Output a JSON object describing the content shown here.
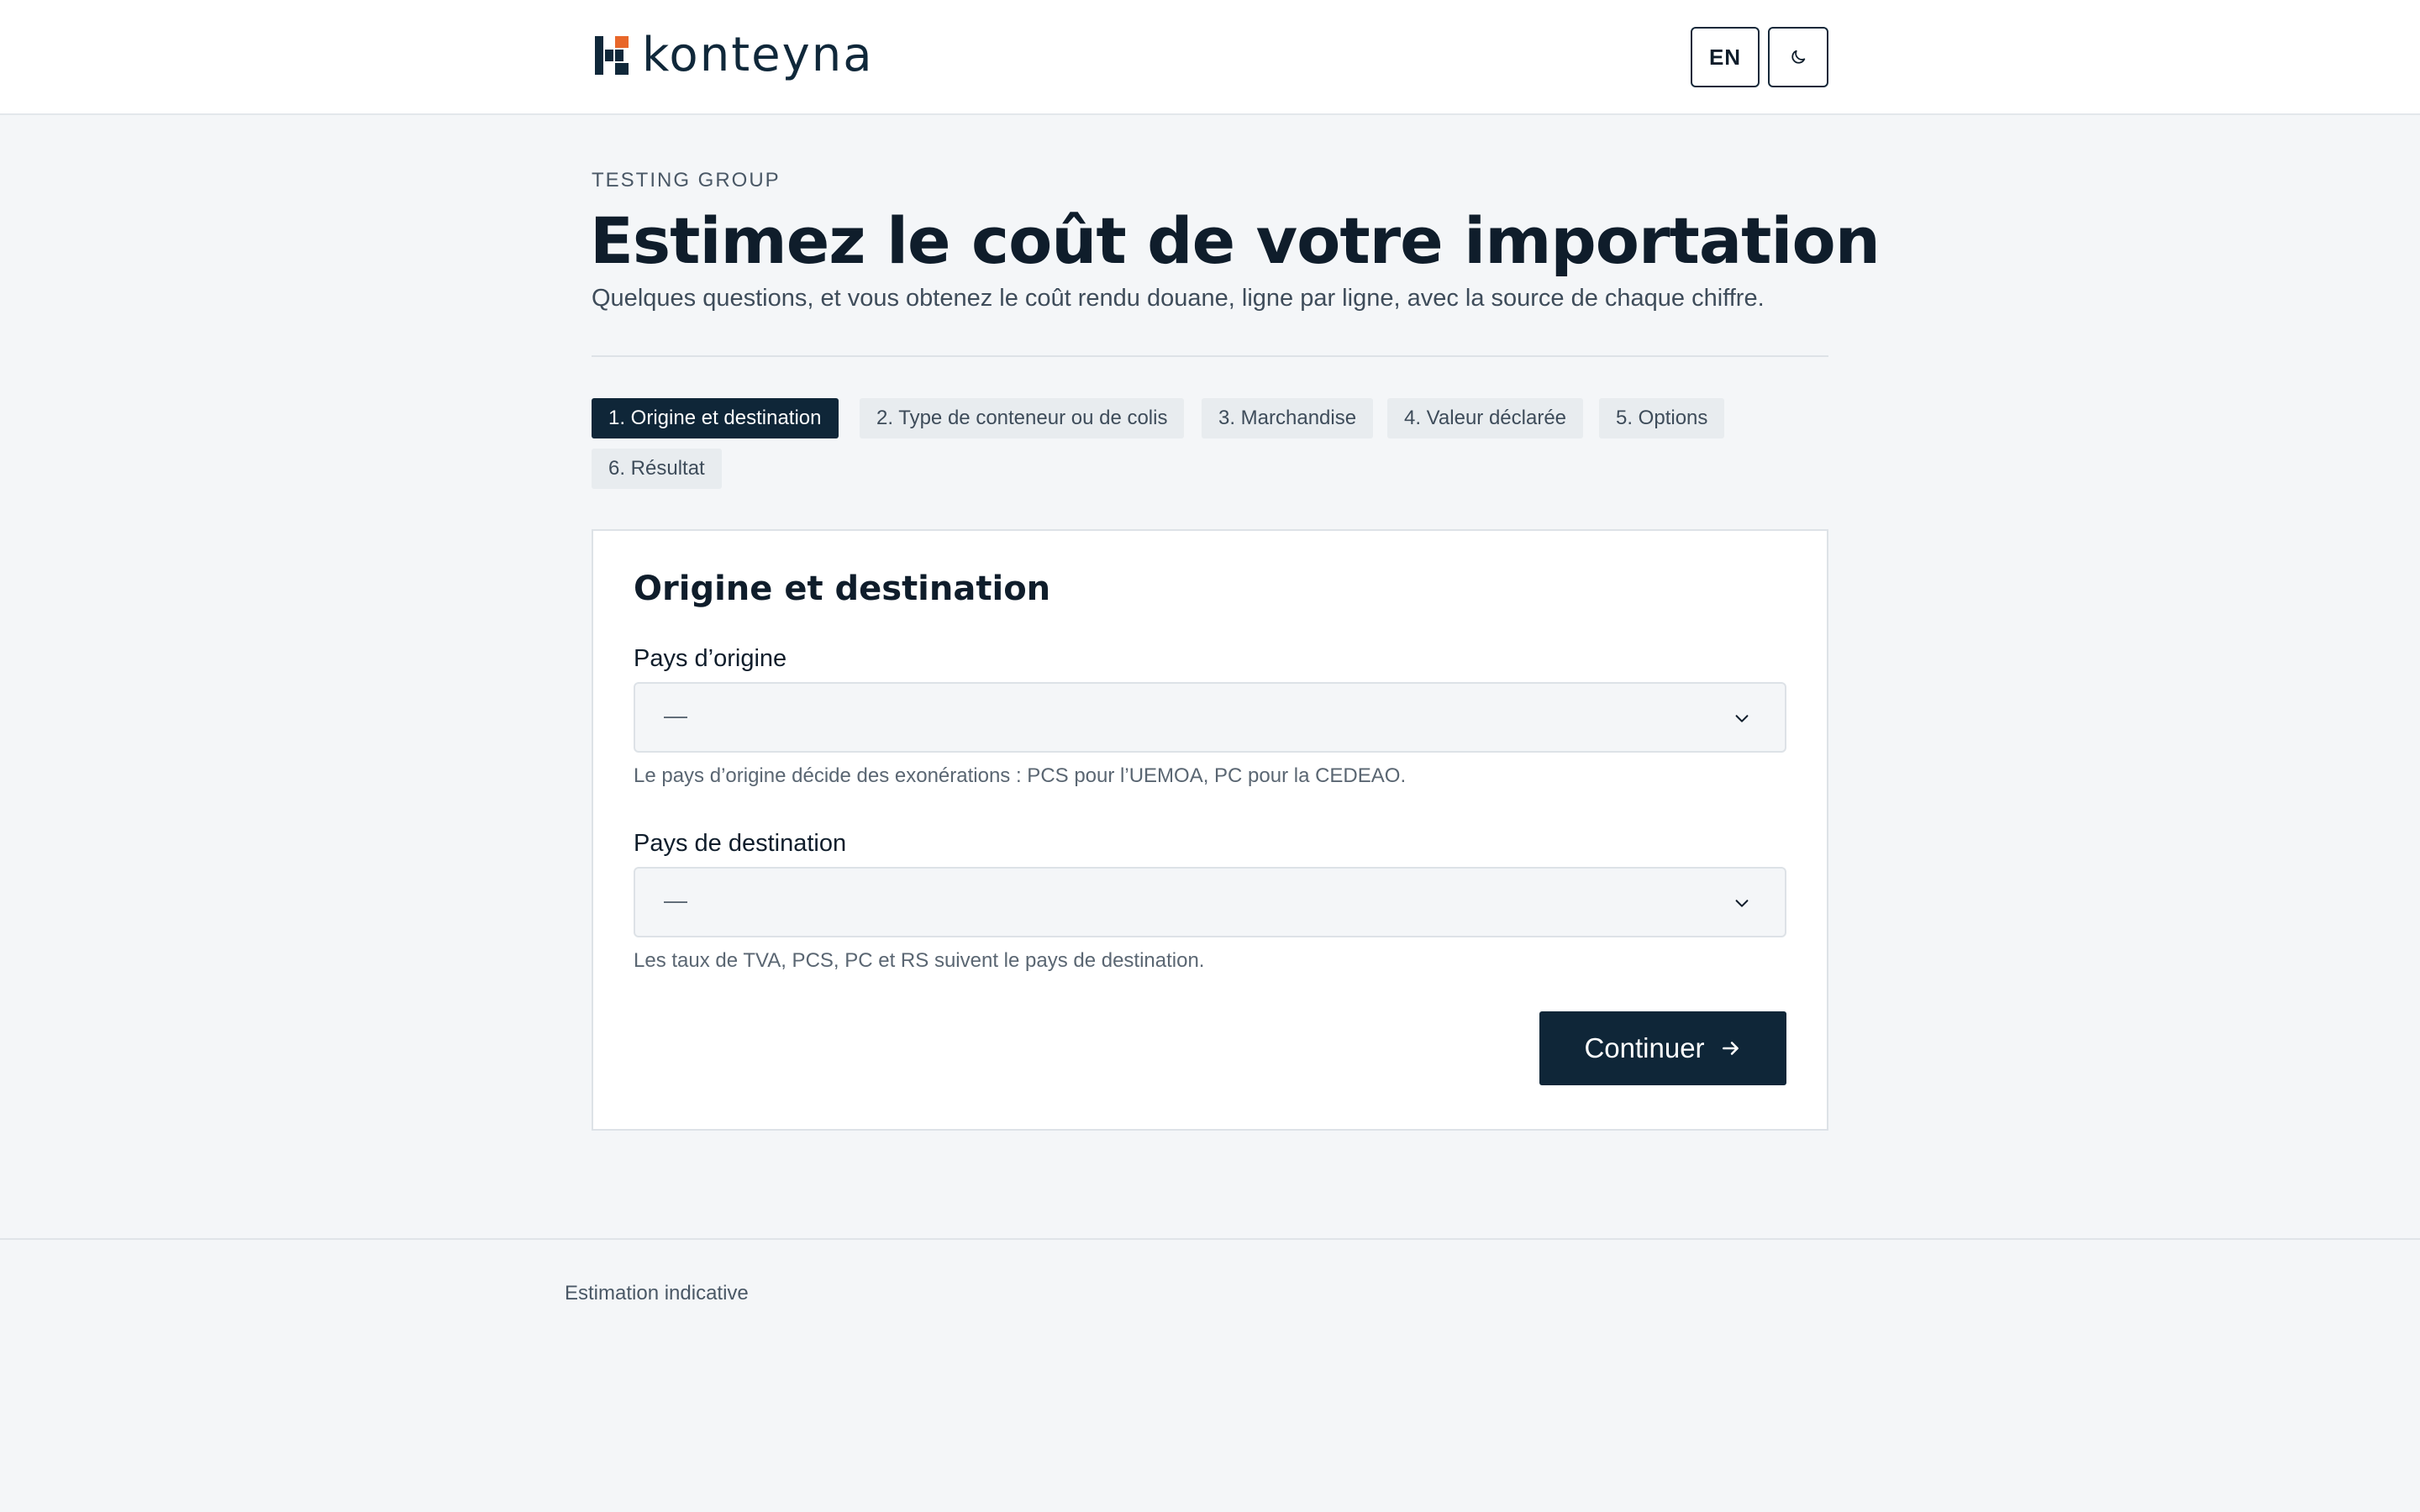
{
  "header": {
    "brand": "konteyna",
    "lang_label": "EN",
    "theme_icon": "moon-icon"
  },
  "intro": {
    "eyebrow": "TESTING GROUP",
    "title": "Estimez le coût de votre importation",
    "subtitle": "Quelques questions, et vous obtenez le coût rendu douane, ligne par ligne, avec la source de chaque chiffre."
  },
  "steps": [
    {
      "label": "1. Origine et destination",
      "active": true
    },
    {
      "label": "2. Type de conteneur ou de colis",
      "active": false
    },
    {
      "label": "3. Marchandise",
      "active": false
    },
    {
      "label": "4. Valeur déclarée",
      "active": false
    },
    {
      "label": "5. Options",
      "active": false
    },
    {
      "label": "6. Résultat",
      "active": false
    }
  ],
  "form": {
    "title": "Origine et destination",
    "origin": {
      "label": "Pays d’origine",
      "value": "—",
      "hint": "Le pays d’origine décide des exonérations : PCS pour l’UEMOA, PC pour la CEDEAO."
    },
    "destination": {
      "label": "Pays de destination",
      "value": "—",
      "hint": "Les taux de TVA, PCS, PC et RS suivent le pays de destination."
    },
    "continue_label": "Continuer"
  },
  "footer": {
    "text": "Estimation indicative"
  },
  "colors": {
    "primary": "#0f2638",
    "accent": "#e8672a",
    "background": "#f4f6f8"
  }
}
